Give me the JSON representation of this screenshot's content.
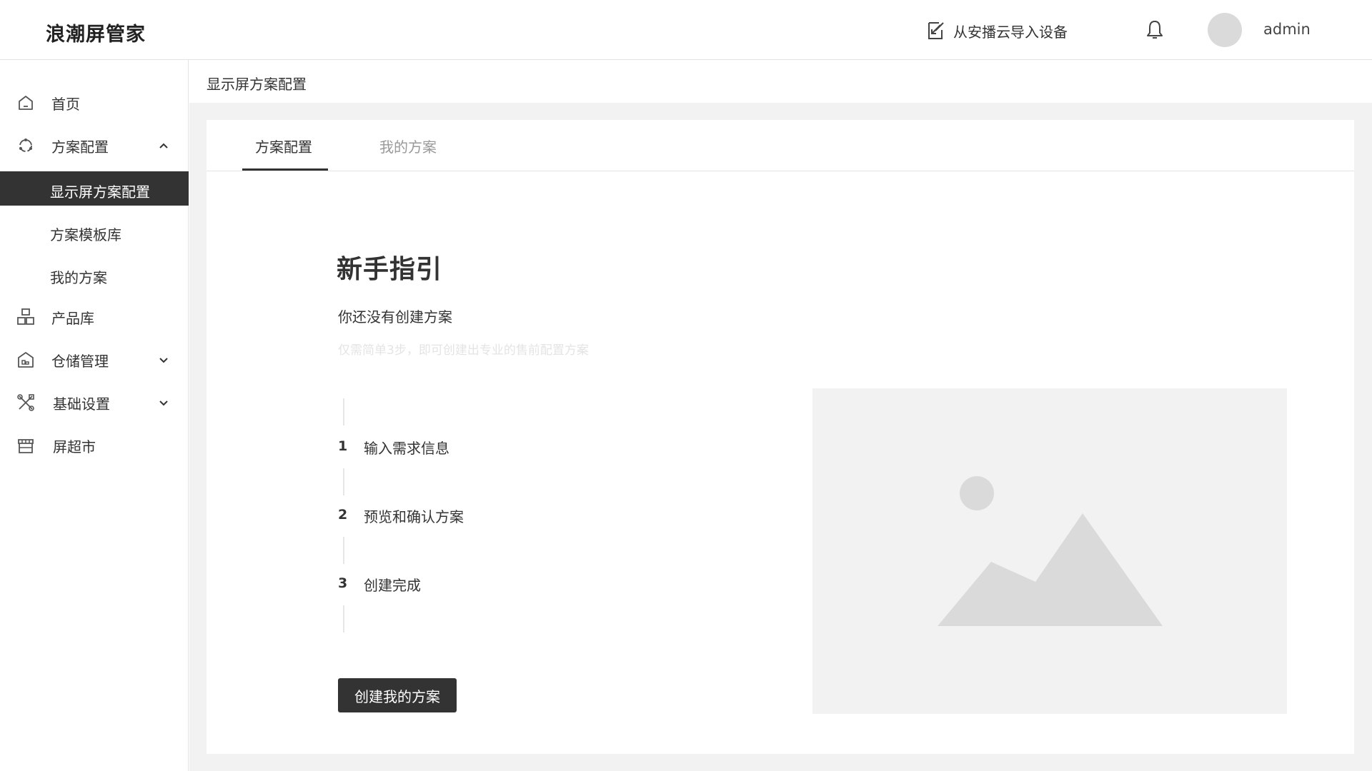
{
  "header": {
    "brand": "浪潮屏管家",
    "import_label": "从安播云导入设备",
    "username": "admin"
  },
  "sidebar": {
    "items": [
      {
        "label": "首页",
        "icon": "home-icon"
      },
      {
        "label": "方案配置",
        "icon": "scheme-icon",
        "expanded": true
      },
      {
        "label": "产品库",
        "icon": "product-icon"
      },
      {
        "label": "仓储管理",
        "icon": "warehouse-icon",
        "expanded": false
      },
      {
        "label": "基础设置",
        "icon": "tools-icon",
        "expanded": false
      },
      {
        "label": "屏超市",
        "icon": "store-icon"
      }
    ],
    "sub_items": [
      {
        "label": "显示屏方案配置",
        "active": true
      },
      {
        "label": "方案模板库",
        "active": false
      },
      {
        "label": "我的方案",
        "active": false
      }
    ]
  },
  "breadcrumb": "显示屏方案配置",
  "tabs": [
    {
      "label": "方案配置",
      "active": true
    },
    {
      "label": "我的方案",
      "active": false
    }
  ],
  "guide": {
    "title": "新手指引",
    "subtitle": "你还没有创建方案",
    "hint": "仅需简单3步，即可创建出专业的售前配置方案",
    "steps": [
      {
        "num": "1",
        "text": "输入需求信息"
      },
      {
        "num": "2",
        "text": "预览和确认方案"
      },
      {
        "num": "3",
        "text": "创建完成"
      }
    ],
    "button_label": "创建我的方案"
  },
  "colors": {
    "dark": "#333333",
    "border": "#e3e3e3",
    "background": "#f2f2f2",
    "placeholder": "#dadada"
  }
}
